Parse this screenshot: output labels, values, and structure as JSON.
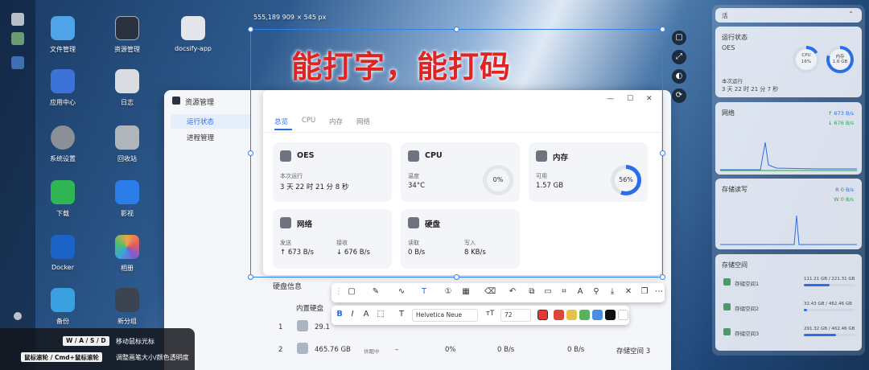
{
  "desktop": {
    "icons": [
      {
        "label": "文件管理",
        "color": "#4fa3e8"
      },
      {
        "label": "资源管理",
        "color": "#2a3240"
      },
      {
        "label": "docsify-app",
        "color": "#e3e6ea"
      },
      {
        "label": "应用中心",
        "color": "#3d73d9"
      },
      {
        "label": "日志",
        "color": "#d9dce1"
      },
      {
        "label": "系统设置",
        "color": "#8a8f98"
      },
      {
        "label": "回收站",
        "color": "#b0b4bb"
      },
      {
        "label": "下载",
        "color": "#2fb552"
      },
      {
        "label": "影视",
        "color": "#2b7de9"
      },
      {
        "label": "Docker",
        "color": "#1b63c6"
      },
      {
        "label": "相册",
        "color": "#f0a347"
      },
      {
        "label": "备份",
        "color": "#3aa0e0"
      },
      {
        "label": "新分组",
        "color": "#3c4452"
      }
    ]
  },
  "resource_manager": {
    "title": "资源管理",
    "nav": [
      "运行状态",
      "进程管理"
    ],
    "disk_title": "硬盘信息",
    "disk_header": "内置硬盘",
    "disk_rows": [
      {
        "index": "1",
        "size": "29.1"
      },
      {
        "index": "2",
        "size": "465.76 GB",
        "status": "休眠中",
        "dash": "–",
        "usage": "0%",
        "read": "0 B/s",
        "write": "0 B/s",
        "pool": "存储空间 3"
      }
    ]
  },
  "app": {
    "tabs": [
      "总览",
      "CPU",
      "内存",
      "网络"
    ],
    "cards": {
      "oes": {
        "title": "OES",
        "key": "本次运行",
        "value": "3 天 22 时 21 分 8 秒"
      },
      "cpu": {
        "title": "CPU",
        "key": "温度",
        "value": "34°C",
        "percent": "0%"
      },
      "memory": {
        "title": "内存",
        "key": "可用",
        "value": "1.57 GB",
        "percent": "56%",
        "percent_value": 56
      },
      "network": {
        "title": "网络",
        "send_key": "发送",
        "send_value": "↑ 673 B/s",
        "recv_key": "接收",
        "recv_value": "↓ 676 B/s"
      },
      "disk": {
        "title": "硬盘",
        "read_key": "读取",
        "read_value": "0 B/s",
        "write_key": "写入",
        "write_value": "8 KB/s"
      }
    }
  },
  "screenshot": {
    "selection_info": "555,189  909 × 545  px",
    "annotation_text": "能打字，能打码",
    "font_family": "Helvetica Neue",
    "font_size": "72",
    "swatches": [
      "#e53935",
      "#e0453a",
      "#e6c24a",
      "#58b35d",
      "#4a8de0",
      "#111111",
      "#ffffff"
    ]
  },
  "widgets": {
    "header_label": "活",
    "status": {
      "title": "运行状态",
      "name": "OES",
      "cpu_label": "CPU",
      "cpu_value": "16%",
      "mem_label": "内存",
      "mem_value": "1.6 GB",
      "uptime_label": "本次运行",
      "uptime_value": "3 天 22 时 21 分 7 秒"
    },
    "network": {
      "title": "网络",
      "up": "↑ 673 B/s",
      "down": "↓ 676 B/s"
    },
    "storage_rw": {
      "title": "存储读写",
      "read": "R 0 B/s",
      "write": "W 0 B/s"
    },
    "storage_space": {
      "title": "存储空间",
      "items": [
        {
          "name": "存储空间1",
          "usage": "111.21 GB / 221.31 GB",
          "fraction": 0.5
        },
        {
          "name": "存储空间2",
          "usage": "32.43 GB / 462.46 GB",
          "fraction": 0.07
        },
        {
          "name": "存储空间3",
          "usage": "291.32 GB / 462.46 GB",
          "fraction": 0.63
        }
      ]
    }
  },
  "hints": [
    {
      "key": "W / A / S / D",
      "text": "移动鼠标光标"
    },
    {
      "key": "鼠标滚轮 / Cmd+鼠标滚轮",
      "text": "调整画笔大小/颜色透明度"
    }
  ]
}
